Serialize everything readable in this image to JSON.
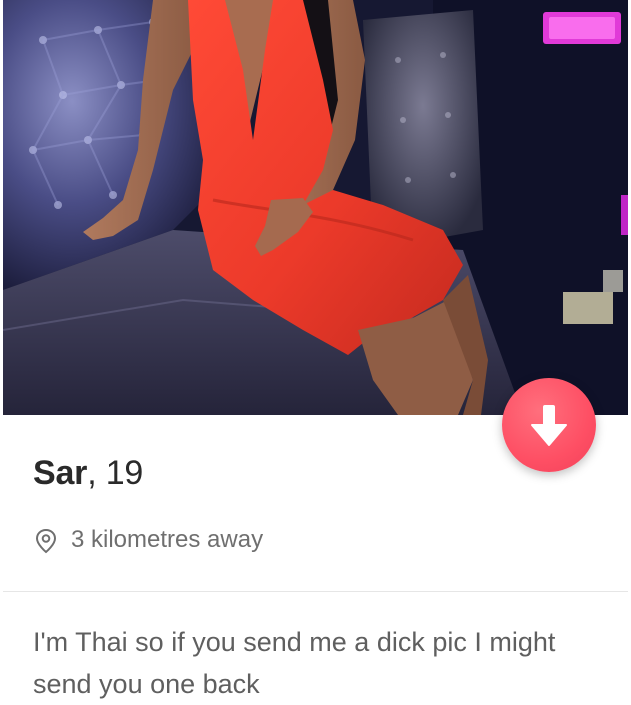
{
  "profile": {
    "name": "Sar",
    "age_text": ", 19",
    "distance": "3 kilometres away",
    "bio": "I'm Thai so if you send me a dick pic I might send you one back"
  },
  "icons": {
    "down_button": "arrow-down-icon",
    "distance": "location-pin-icon"
  },
  "colors": {
    "accent": "#fe4f64",
    "name_text": "#2a2a2a",
    "secondary_text": "#6f6f6f"
  }
}
